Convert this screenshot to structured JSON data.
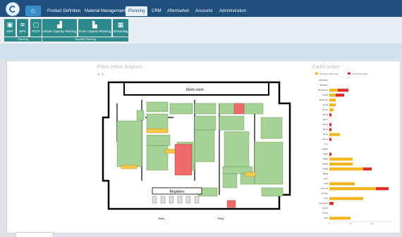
{
  "menu": [
    "Product Definition",
    "Material Management",
    "Planning",
    "CRM",
    "Aftermarket",
    "Accounts",
    "Administration"
  ],
  "active_menu": "Planning",
  "ribbon": {
    "buttons": [
      {
        "label": "MRP",
        "icon": "mrp-icon"
      },
      {
        "label": "MPS",
        "icon": "mps-icon"
      },
      {
        "label": "RCCP",
        "icon": "rccp-icon"
      },
      {
        "label": "Infinite Capacity Planning",
        "icon": "bar-chart-icon"
      },
      {
        "label": "Finite Capacity Planning",
        "icon": "bar-chart-icon"
      },
      {
        "label": "Scheduling",
        "icon": "calendar-icon"
      }
    ],
    "groups": [
      "Planning",
      "Capacity Planning"
    ]
  },
  "plant": {
    "title": "Plant status diagram",
    "stock_room": "Stock room",
    "registers": "Registers",
    "entry_label": "Entry"
  },
  "faults": {
    "title": "Faults today",
    "legend": [
      "Intermittent faults today",
      "Critical faults today"
    ],
    "colors": {
      "intermittent": "#f3b51b",
      "critical": "#e02828"
    },
    "x_ticks": [
      "0",
      "10",
      "20"
    ],
    "rows": [
      {
        "label": "ABCDEFG",
        "i": 0,
        "c": 0
      },
      {
        "label": "BCDEFG",
        "i": 0,
        "c": 0
      },
      {
        "label": "BCDEFGHI",
        "i": 4,
        "c": 5
      },
      {
        "label": "BCDE",
        "i": 3,
        "c": 4
      },
      {
        "label": "BCDE HIJ",
        "i": 3,
        "c": 0
      },
      {
        "label": "BYTE",
        "i": 3,
        "c": 0
      },
      {
        "label": "BKGE",
        "i": 2,
        "c": 0
      },
      {
        "label": "BKYE",
        "i": 0,
        "c": 1
      },
      {
        "label": "BKYT",
        "i": 0,
        "c": 0
      },
      {
        "label": "BKYE",
        "i": 0,
        "c": 1
      },
      {
        "label": "BKYE",
        "i": 0,
        "c": 1
      },
      {
        "label": "BKYE",
        "i": 5,
        "c": 0
      },
      {
        "label": "BKYE",
        "i": 0,
        "c": 1
      },
      {
        "label": "CYC",
        "i": 0,
        "c": 0
      },
      {
        "label": "CDEEF",
        "i": 0,
        "c": 0
      },
      {
        "label": "CDEF",
        "i": 0,
        "c": 1
      },
      {
        "label": "DDEE",
        "i": 11,
        "c": 0
      },
      {
        "label": "DDEE",
        "i": 11,
        "c": 0
      },
      {
        "label": "DDEE",
        "i": 16,
        "c": 4
      },
      {
        "label": "EEEE",
        "i": 0,
        "c": 0
      },
      {
        "label": "EGH",
        "i": 0,
        "c": 0
      },
      {
        "label": "FNE",
        "i": 12,
        "c": 0
      },
      {
        "label": "FNGLYN",
        "i": 22,
        "c": 6
      },
      {
        "label": "PITNAL",
        "i": 0,
        "c": 0
      },
      {
        "label": "PHT",
        "i": 16,
        "c": 0
      },
      {
        "label": "PLMHOST",
        "i": 0,
        "c": 2
      },
      {
        "label": "ROST",
        "i": 0,
        "c": 0
      },
      {
        "label": "SNTO",
        "i": 0,
        "c": 0
      },
      {
        "label": "YTGF",
        "i": 10,
        "c": 0
      }
    ]
  }
}
